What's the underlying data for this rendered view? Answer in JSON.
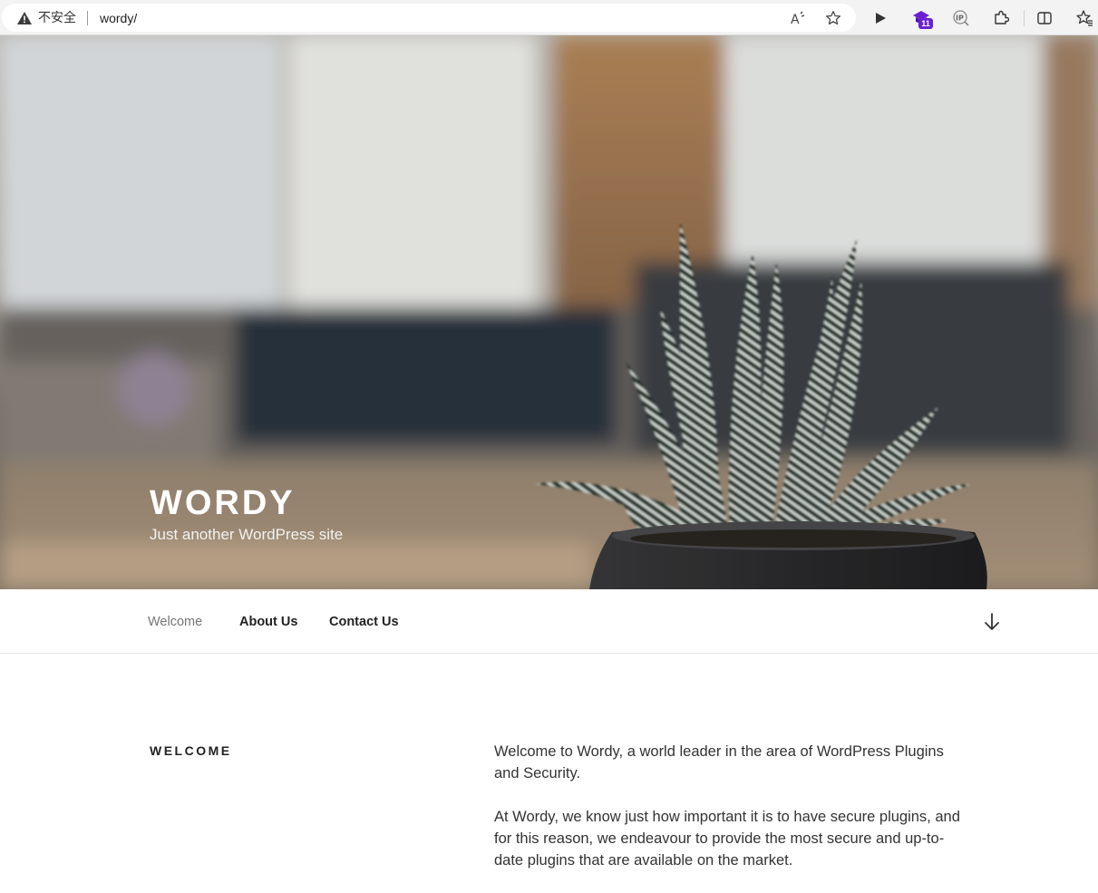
{
  "browser": {
    "security_label": "不安全",
    "url": "wordy/",
    "extension_badge": "11",
    "icons": [
      "warning-icon",
      "read-aloud-icon",
      "favorite-star-icon",
      "play-icon",
      "extension-icon",
      "ip-icon",
      "puzzle-icon",
      "split-screen-icon",
      "favorites-icon"
    ],
    "accent_color": "#6b1fd1"
  },
  "hero": {
    "site_title": "WORDY",
    "tagline": "Just another WordPress site"
  },
  "nav": {
    "items": [
      {
        "label": "Welcome",
        "current": true
      },
      {
        "label": "About Us",
        "current": false
      },
      {
        "label": "Contact Us",
        "current": false
      }
    ],
    "scroll_icon": "arrow-down-icon"
  },
  "content": {
    "section_title": "WELCOME",
    "paragraphs": [
      "Welcome to Wordy, a world leader in the area of WordPress Plugins and Security.",
      "At Wordy, we know just how important it is to have secure plugins, and for this reason, we endeavour to provide the most secure and up-to-date plugins that are available on the market."
    ]
  }
}
